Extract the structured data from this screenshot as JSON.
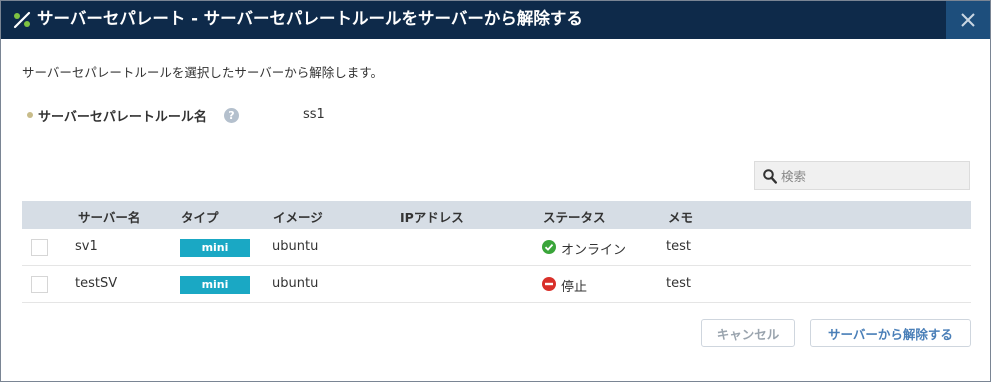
{
  "dialog": {
    "title": "サーバーセパレート - サーバーセパレートルールをサーバーから解除する",
    "title_icon": "separate-rule-icon",
    "close_icon": "close-icon",
    "description": "サーバーセパレートルールを選択したサーバーから解除します。"
  },
  "rule": {
    "label": "サーバーセパレートルール名",
    "help_glyph": "?",
    "value": "ss1"
  },
  "search": {
    "placeholder": "検索",
    "value": ""
  },
  "table": {
    "headers": {
      "name": "サーバー名",
      "type": "タイプ",
      "image": "イメージ",
      "ip": "IPアドレス",
      "status": "ステータス",
      "memo": "メモ"
    },
    "rows": [
      {
        "name": "sv1",
        "type": "mini",
        "image": "ubuntu",
        "ip": "",
        "status": "オンライン",
        "status_icon": "online-check-icon",
        "status_color": "#3aa53a",
        "memo": "test",
        "checked": false
      },
      {
        "name": "testSV",
        "type": "mini",
        "image": "ubuntu",
        "ip": "",
        "status": "停止",
        "status_icon": "stopped-icon",
        "status_color": "#d9302a",
        "memo": "test",
        "checked": false
      }
    ]
  },
  "buttons": {
    "cancel": "キャンセル",
    "confirm": "サーバーから解除する"
  },
  "colors": {
    "titlebar": "#0e2a4a",
    "close_bg": "#1d4e7c",
    "header_bg": "#d6dde5",
    "badge": "#1aa8c4",
    "confirm_text": "#4a7fb8"
  }
}
